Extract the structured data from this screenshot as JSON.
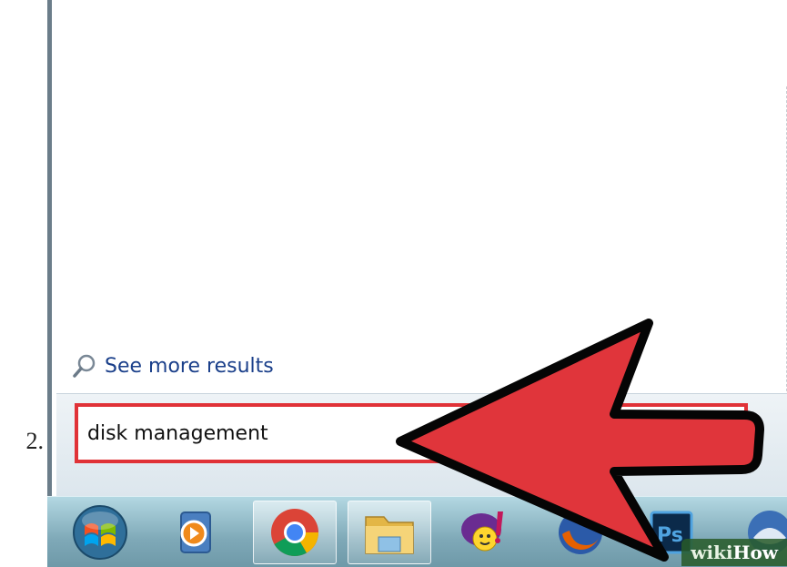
{
  "step_number": "2.",
  "start_menu": {
    "see_more_results": "See more results",
    "search_value": "disk management"
  },
  "taskbar": {
    "items": [
      {
        "name": "start-orb-icon"
      },
      {
        "name": "windows-media-player-icon"
      },
      {
        "name": "chrome-icon"
      },
      {
        "name": "windows-explorer-icon"
      },
      {
        "name": "yahoo-messenger-icon"
      },
      {
        "name": "firefox-icon"
      },
      {
        "name": "photoshop-icon",
        "label": "Ps"
      },
      {
        "name": "thunderbird-icon"
      }
    ]
  },
  "watermark": {
    "wiki": "wiki",
    "how": "How"
  },
  "colors": {
    "arrow": "#e0353b",
    "search_border": "#e03237",
    "link": "#1a3f8a"
  }
}
